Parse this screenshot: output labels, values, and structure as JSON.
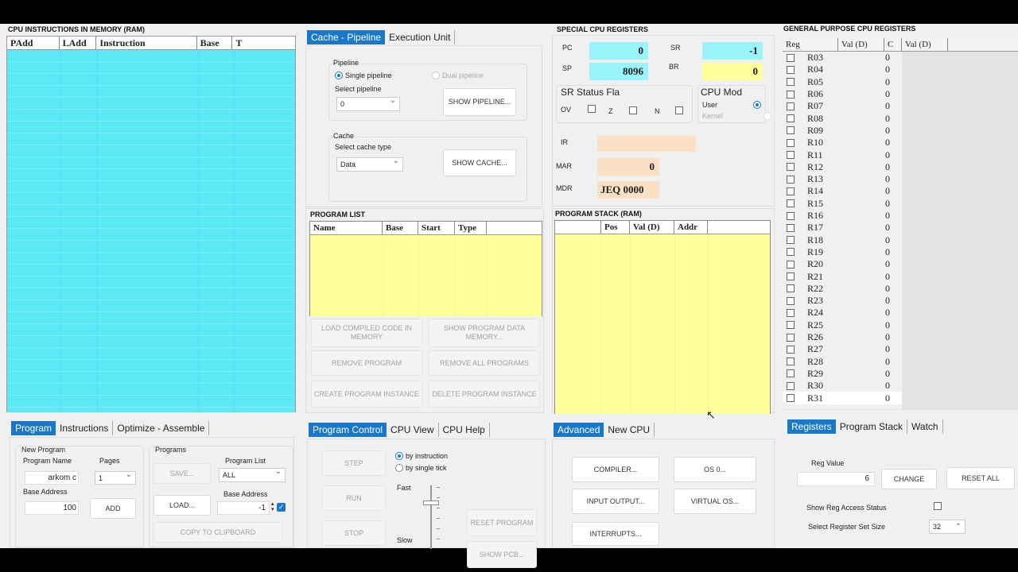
{
  "memory": {
    "title": "CPU INSTRUCTIONS IN MEMORY (RAM)",
    "columns": [
      "PAdd",
      "LAdd",
      "Instruction",
      "Base",
      "T"
    ],
    "bg": "#99f3fa"
  },
  "pipeline_tabs": [
    "Cache - Pipeline",
    "Execution Unit"
  ],
  "pipeline": {
    "group_label": "Pipeline",
    "single": "Single pipeline",
    "dual": "Dual pipeline",
    "select_label": "Select pipeline",
    "select_value": "0",
    "show_button": "SHOW PIPELINE..."
  },
  "cache": {
    "group_label": "Cache",
    "select_label": "Select cache type",
    "select_value": "Data",
    "show_button": "SHOW    CACHE..."
  },
  "special": {
    "title": "SPECIAL CPU REGISTERS",
    "pc_label": "PC",
    "pc_value": "",
    "sp_label": "SP",
    "sp_value": "8096",
    "sr_label": "SR",
    "sr_value": "-1",
    "br_label": "BR",
    "br_value": "0",
    "pc_box_value": "0",
    "flags_title": "SR Status Fla",
    "flags": [
      "OV",
      "Z",
      "N"
    ],
    "mode_title": "CPU Mod",
    "mode_user": "User",
    "mode_kernel": "Kernel",
    "ir_label": "IR",
    "ir_value": "",
    "mar_label": "MAR",
    "mar_value": "0",
    "mdr_label": "MDR",
    "mdr_value": "JEQ 0000",
    "cyan": "#99f3fa",
    "yellow": "#ffff99",
    "peach": "#fbe0c4"
  },
  "general": {
    "title": "GENERAL PURPOSE CPU REGISTERS",
    "columns": [
      "Reg",
      "Val (D)",
      "C",
      "Val (D)"
    ],
    "rows": [
      {
        "reg": "R03",
        "val": "0"
      },
      {
        "reg": "R04",
        "val": "0"
      },
      {
        "reg": "R05",
        "val": "0"
      },
      {
        "reg": "R06",
        "val": "0"
      },
      {
        "reg": "R07",
        "val": "0"
      },
      {
        "reg": "R08",
        "val": "0"
      },
      {
        "reg": "R09",
        "val": "0"
      },
      {
        "reg": "R10",
        "val": "0"
      },
      {
        "reg": "R11",
        "val": "0"
      },
      {
        "reg": "R12",
        "val": "0"
      },
      {
        "reg": "R13",
        "val": "0"
      },
      {
        "reg": "R14",
        "val": "0"
      },
      {
        "reg": "R15",
        "val": "0"
      },
      {
        "reg": "R16",
        "val": "0"
      },
      {
        "reg": "R17",
        "val": "0"
      },
      {
        "reg": "R18",
        "val": "0"
      },
      {
        "reg": "R19",
        "val": "0"
      },
      {
        "reg": "R20",
        "val": "0"
      },
      {
        "reg": "R21",
        "val": "0"
      },
      {
        "reg": "R22",
        "val": "0"
      },
      {
        "reg": "R23",
        "val": "0"
      },
      {
        "reg": "R24",
        "val": "0"
      },
      {
        "reg": "R25",
        "val": "0"
      },
      {
        "reg": "R26",
        "val": "0"
      },
      {
        "reg": "R27",
        "val": "0"
      },
      {
        "reg": "R28",
        "val": "0"
      },
      {
        "reg": "R29",
        "val": "0"
      },
      {
        "reg": "R30",
        "val": "0"
      },
      {
        "reg": "R31",
        "val": "0"
      }
    ]
  },
  "program_list": {
    "title": "PROGRAM LIST",
    "columns": [
      "Name",
      "Base",
      "Start",
      "Type"
    ],
    "buttons": [
      "LOAD COMPILED CODE IN MEMORY",
      "SHOW PROGRAM  DATA MEMORY...",
      "REMOVE PROGRAM",
      "REMOVE ALL PROGRAMS",
      "CREATE PROGRAM INSTANCE",
      "DELETE PROGRAM INSTANCE"
    ]
  },
  "stack": {
    "title": "PROGRAM STACK (RAM)",
    "columns": [
      "",
      "Pos",
      "Val (D)",
      "Addr"
    ]
  },
  "bottom_left": {
    "tabs": [
      "Program",
      "Instructions",
      "Optimize - Assemble"
    ],
    "new_program": "New Program",
    "program_name_label": "Program Name",
    "program_name_value": "arkom c",
    "pages_label": "Pages",
    "pages_value": "1",
    "base_address_label": "Base Address",
    "base_address_value": "100",
    "add_button": "ADD",
    "programs_label": "Programs",
    "save_button": "SAVE...",
    "program_list_label": "Program List",
    "program_list_value": "ALL",
    "load_button": "LOAD...",
    "base_address2_label": "Base Address",
    "base_address2_value": "-1",
    "copy_button": "COPY TO CLIPBOARD"
  },
  "program_control": {
    "tabs": [
      "Program Control",
      "CPU View",
      "CPU Help"
    ],
    "step": "STEP",
    "run": "RUN",
    "stop": "STOP",
    "by_instruction": "by instruction",
    "by_tick": "by single tick",
    "fast": "Fast",
    "slow": "Slow",
    "reset_program": "RESET PROGRAM",
    "show_pcb": "SHOW PCB..."
  },
  "advanced": {
    "tabs": [
      "Advanced",
      "New CPU"
    ],
    "compiler": "COMPILER...",
    "os": "OS 0...",
    "io": "INPUT OUTPUT...",
    "virtual_os": "VIRTUAL OS...",
    "interrupts": "INTERRUPTS..."
  },
  "registers_panel": {
    "tabs": [
      "Registers",
      "Program Stack",
      "Watch"
    ],
    "reg_value_label": "Reg Value",
    "reg_value": "6",
    "change": "CHANGE",
    "reset_all": "RESET ALL",
    "show_access": "Show Reg Access Status",
    "set_size_label": "Select Register Set Size",
    "set_size_value": "32"
  }
}
